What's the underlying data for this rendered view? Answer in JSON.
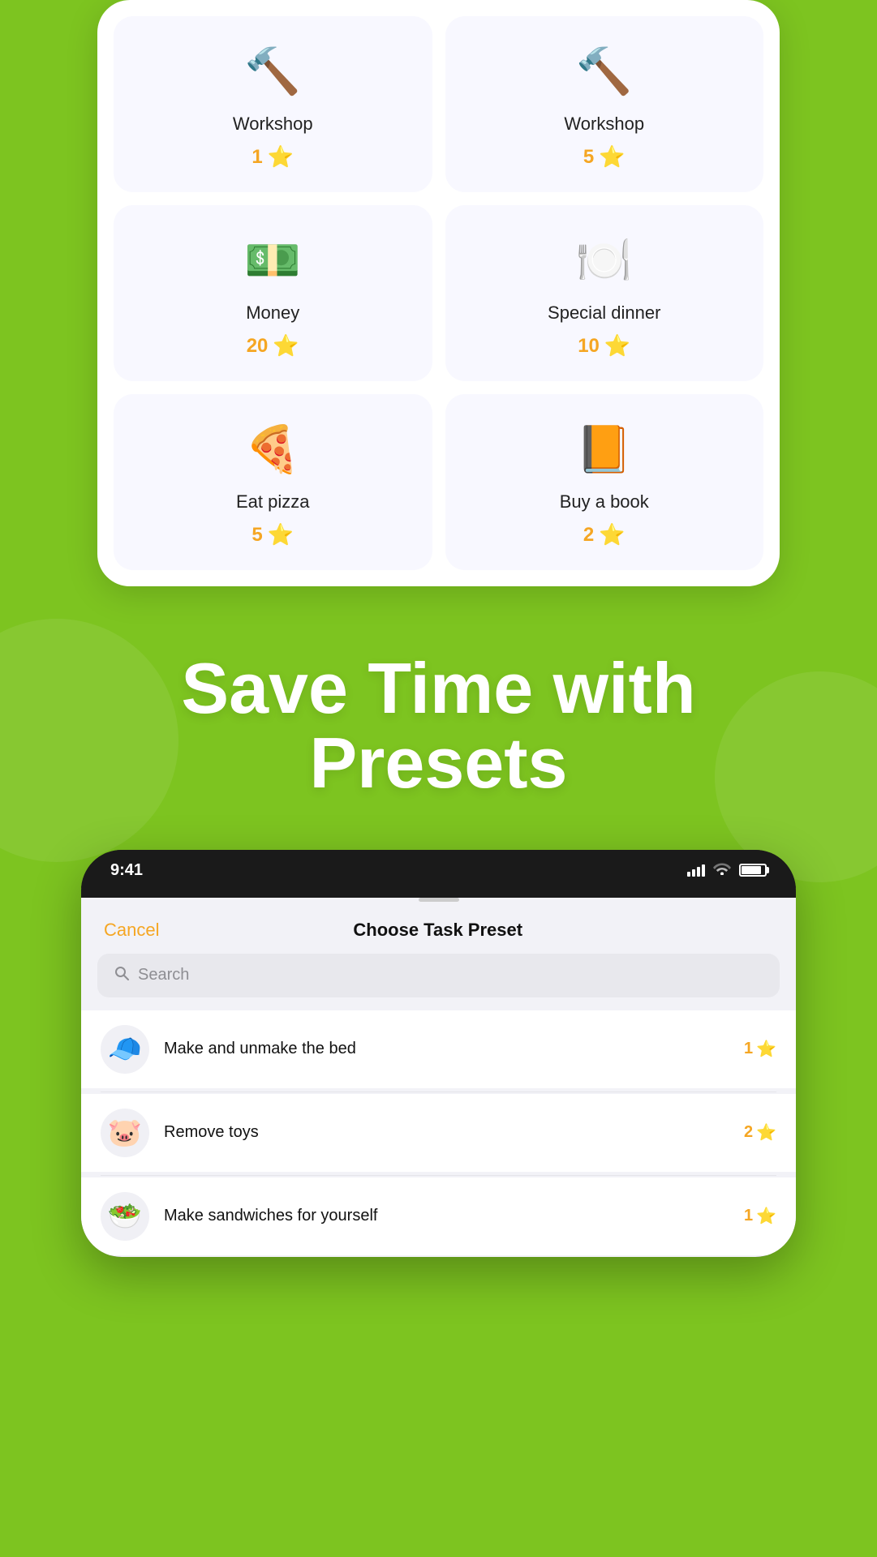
{
  "topPhone": {
    "rewards": [
      {
        "id": "workshop1",
        "name": "Workshop",
        "points": 1,
        "emoji": "🔨"
      },
      {
        "id": "workshop5",
        "name": "Workshop",
        "points": 5,
        "emoji": "🔨"
      },
      {
        "id": "money20",
        "name": "Money",
        "points": 20,
        "emoji": "💵"
      },
      {
        "id": "specialdinner",
        "name": "Special dinner",
        "points": 10,
        "emoji": "🍽️"
      },
      {
        "id": "eatpizza",
        "name": "Eat pizza",
        "points": 5,
        "emoji": "🍕"
      },
      {
        "id": "buybook",
        "name": "Buy a book",
        "points": 2,
        "emoji": "📙"
      }
    ]
  },
  "headline": {
    "line1": "Save Time with",
    "line2": "Presets"
  },
  "bottomPhone": {
    "statusBar": {
      "time": "9:41"
    },
    "modal": {
      "cancelLabel": "Cancel",
      "title": "Choose Task Preset",
      "searchPlaceholder": "Search"
    },
    "tasks": [
      {
        "id": "bed",
        "name": "Make and unmake the bed",
        "points": 1,
        "emoji": "🧢"
      },
      {
        "id": "toys",
        "name": "Remove toys",
        "points": 2,
        "emoji": "🐷"
      },
      {
        "id": "sandwiches",
        "name": "Make sandwiches for yourself",
        "points": 1,
        "emoji": "🥗"
      }
    ]
  }
}
